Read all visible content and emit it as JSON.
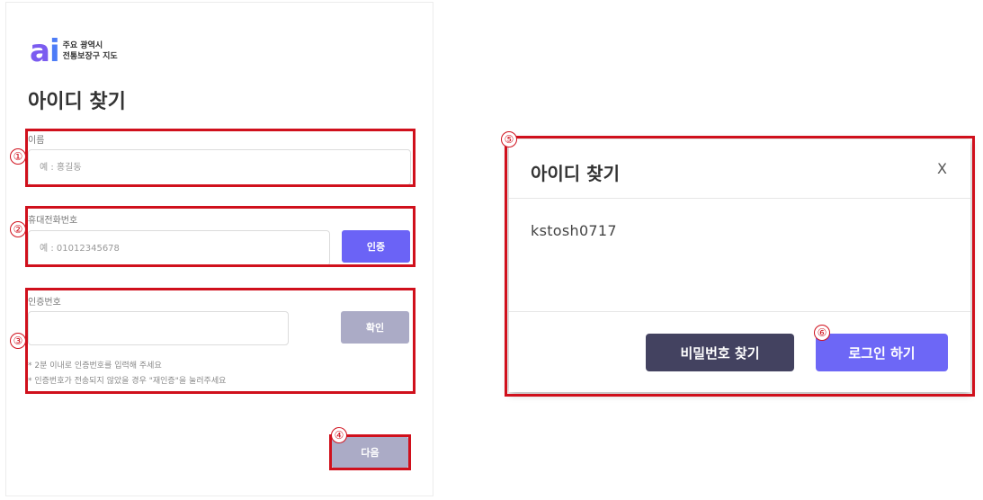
{
  "logo": {
    "mark_a": "a",
    "mark_i": "i",
    "line1": "주요 광역시",
    "line2": "전통보장구 지도"
  },
  "page_title": "아이디 찾기",
  "form": {
    "name": {
      "label": "이름",
      "placeholder": "예 : 홍길동"
    },
    "phone": {
      "label": "휴대전화번호",
      "placeholder": "예 : 01012345678",
      "button": "인증"
    },
    "code": {
      "label": "인증번호",
      "placeholder": "",
      "button": "확인",
      "note1": "* 2분 이내로 인증번호를 입력해 주세요",
      "note2": "* 인증번호가 전송되지 않았을 경우 \"재인증\"을 눌러주세요"
    },
    "next_button": "다음"
  },
  "markers": [
    "①",
    "②",
    "③",
    "④",
    "⑤",
    "⑥"
  ],
  "modal": {
    "title": "아이디 찾기",
    "close": "X",
    "found_id": "kstosh0717",
    "find_password_button": "비밀번호 찾기",
    "login_button": "로그인 하기"
  },
  "colors": {
    "accent": "#6b63f6",
    "disabled": "#ababc6",
    "dark_button": "#434260",
    "highlight": "#d0101c"
  }
}
